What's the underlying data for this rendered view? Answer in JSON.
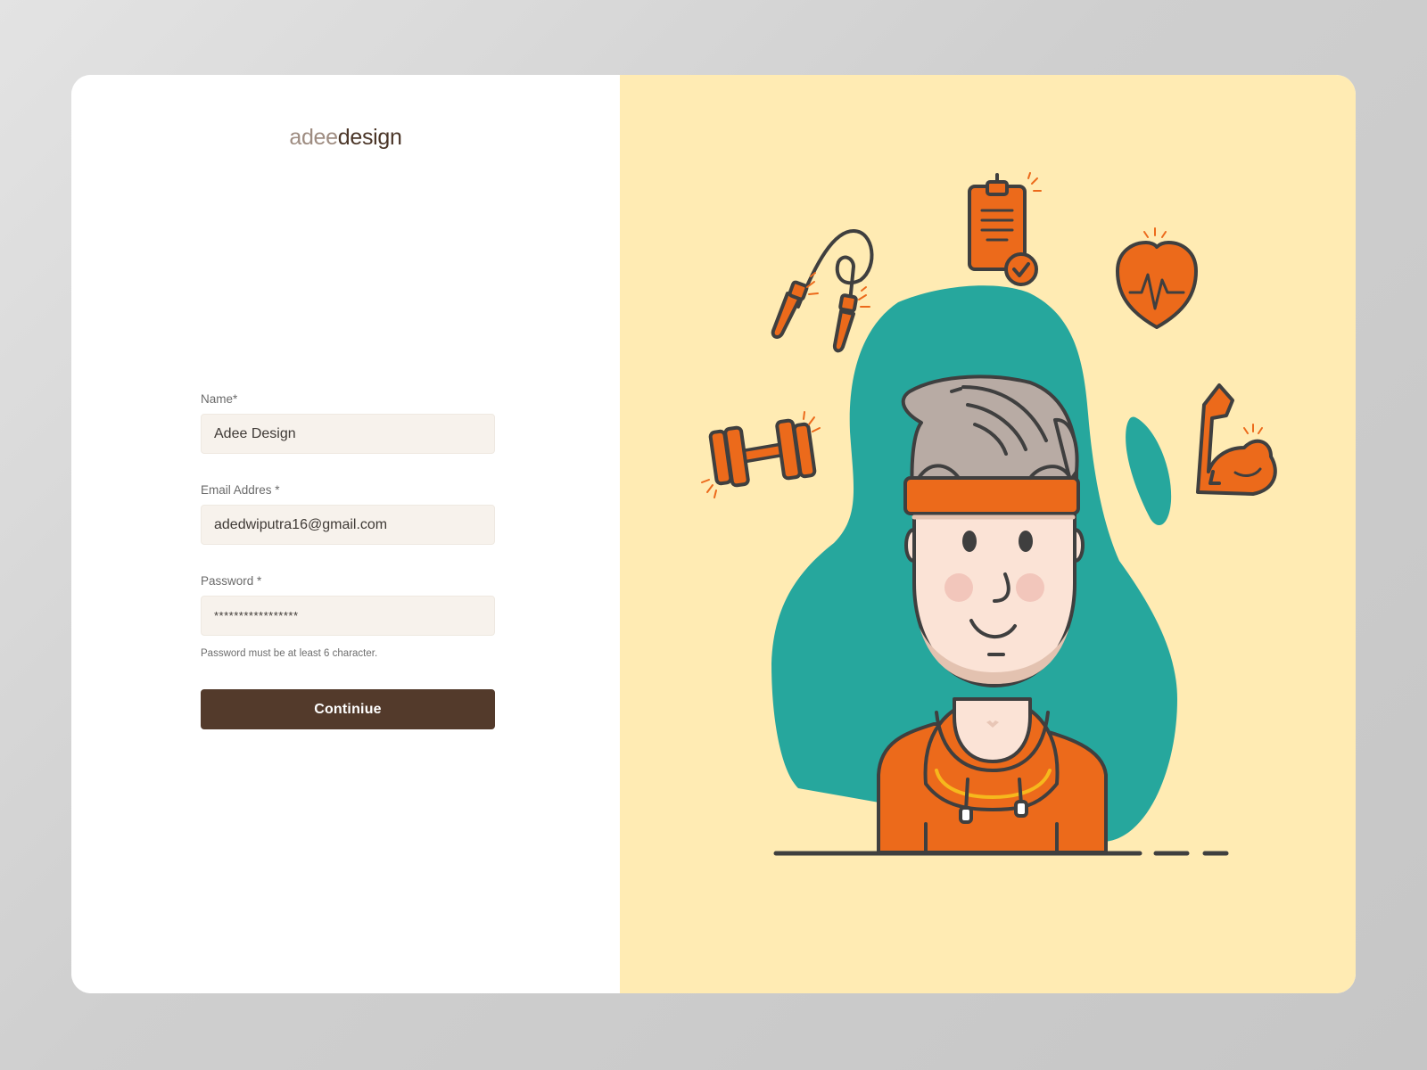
{
  "logo": {
    "light_part": "adee",
    "dark_part": "design"
  },
  "form": {
    "name": {
      "label": "Name*",
      "value": "Adee Design"
    },
    "email": {
      "label": "Email Addres *",
      "value": "adedwiputra16@gmail.com"
    },
    "password": {
      "label": "Password  *",
      "value": "*****************",
      "hint": "Password  must be at least 6 character."
    },
    "submit_label": "Continiue"
  },
  "colors": {
    "brand_brown": "#533a2b",
    "input_bg": "#f7f2ec",
    "illustration_bg": "#ffebb3",
    "accent_orange": "#ec6a1b",
    "blob_teal": "#26a79d"
  },
  "illustration": {
    "icons": [
      "jump-rope-icon",
      "clipboard-check-icon",
      "heart-rate-icon",
      "dumbbell-icon",
      "flexed-arm-icon"
    ],
    "character": "man-with-headband-and-hoodie"
  }
}
